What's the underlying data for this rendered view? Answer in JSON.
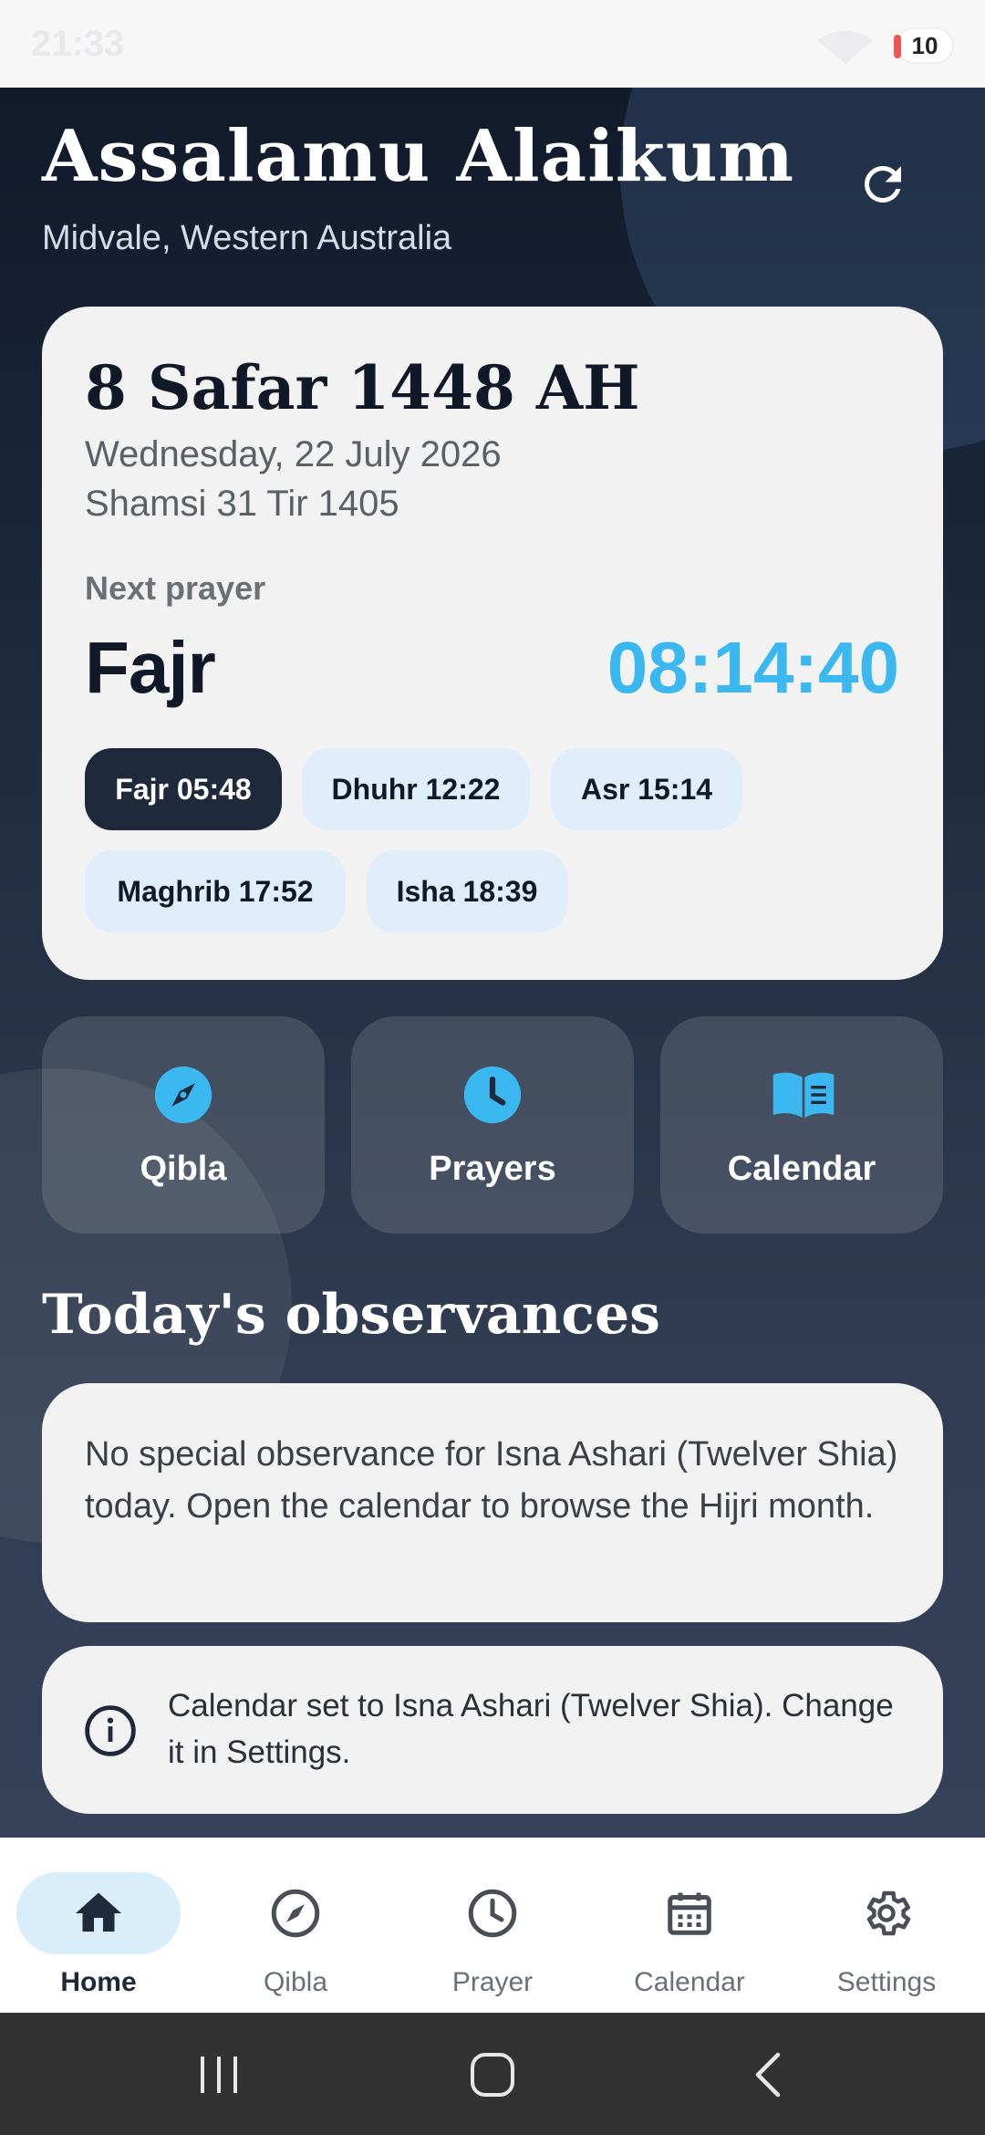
{
  "status_bar": {
    "time": "21:33",
    "battery": "10"
  },
  "header": {
    "greeting": "Assalamu Alaikum",
    "location": "Midvale, Western Australia"
  },
  "date_card": {
    "hijri_date": "8 Safar 1448 AH",
    "gregorian_date": "Wednesday, 22 July 2026",
    "shamsi_date": "Shamsi 31 Tir 1405",
    "next_prayer_label": "Next prayer",
    "next_prayer_name": "Fajr",
    "countdown": "08:14:40",
    "prayers": [
      {
        "label": "Fajr 05:48",
        "active": true
      },
      {
        "label": "Dhuhr 12:22",
        "active": false
      },
      {
        "label": "Asr 15:14",
        "active": false
      },
      {
        "label": "Maghrib 17:52",
        "active": false
      },
      {
        "label": "Isha 18:39",
        "active": false
      }
    ]
  },
  "actions": [
    {
      "label": "Qibla",
      "icon": "compass-icon"
    },
    {
      "label": "Prayers",
      "icon": "clock-icon"
    },
    {
      "label": "Calendar",
      "icon": "book-icon"
    }
  ],
  "observances": {
    "heading": "Today's observances",
    "message": "No special observance for Isna Ashari (Twelver Shia) today. Open the calendar to browse the Hijri month."
  },
  "info": {
    "message": "Calendar set to Isna Ashari (Twelver Shia). Change it in Settings."
  },
  "bottom_nav": [
    {
      "label": "Home",
      "icon": "home-icon",
      "active": true
    },
    {
      "label": "Qibla",
      "icon": "compass-icon",
      "active": false
    },
    {
      "label": "Prayer",
      "icon": "clock-icon",
      "active": false
    },
    {
      "label": "Calendar",
      "icon": "calendar-icon",
      "active": false
    },
    {
      "label": "Settings",
      "icon": "gear-icon",
      "active": false
    }
  ],
  "colors": {
    "accent": "#3bb8f0",
    "dark": "#1e293b",
    "chip_bg": "#dfeefa",
    "nav_active": "#d8eefb"
  }
}
